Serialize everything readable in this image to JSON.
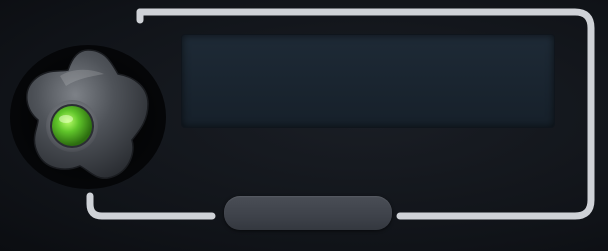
{
  "widget": {
    "display": {
      "text": "",
      "color": "#1e2a36"
    },
    "indicator": {
      "status": "on",
      "color": "#5fc42a"
    },
    "frame_color": "#d8dade",
    "handle_color": "#44484f"
  },
  "icons": {
    "knob": "rotary-knob-icon",
    "indicator": "status-light-icon"
  }
}
